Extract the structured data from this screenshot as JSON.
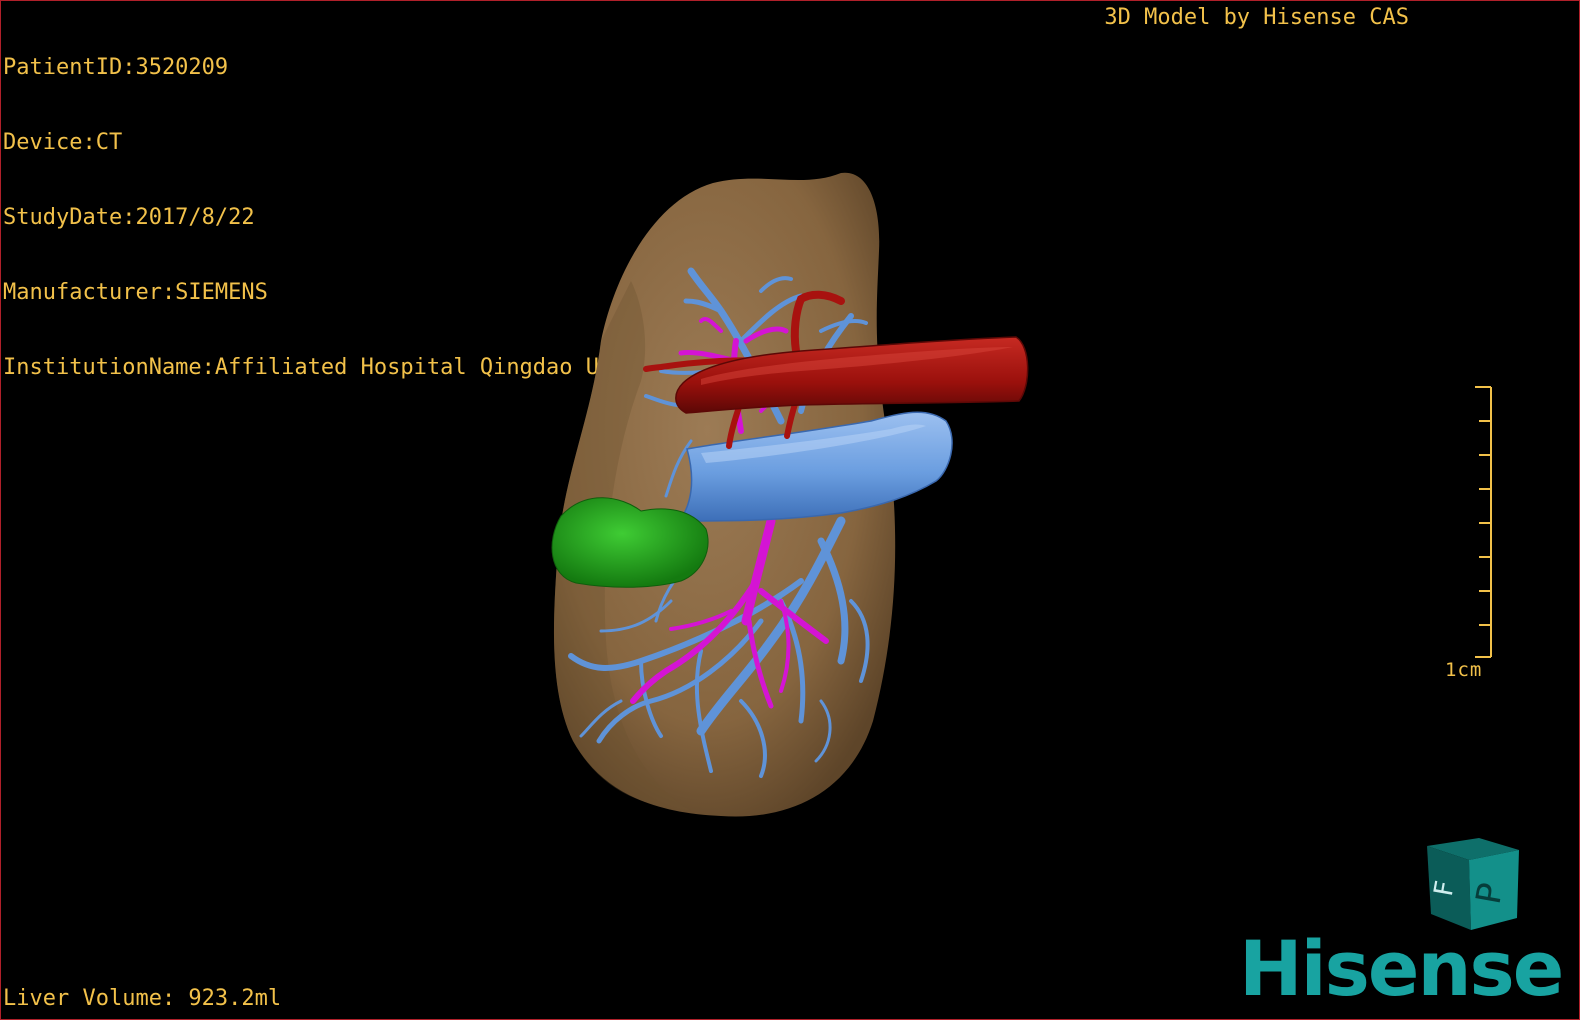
{
  "dicom": {
    "patient_id": "PatientID:3520209",
    "device": "Device:CT",
    "study_date": "StudyDate:2017/8/22",
    "manufacturer": "Manufacturer:SIEMENS",
    "institution": "InstitutionName:Affiliated Hospital Qingdao University-C"
  },
  "credit": "3D Model by Hisense CAS",
  "liver_volume": "Liver Volume: 923.2ml",
  "scale": {
    "label": "1cm"
  },
  "orientation_cube": {
    "face_front": "P",
    "face_side": "F"
  },
  "logo": "Hisense",
  "colors": {
    "overlay_text": "#f2c14a",
    "liver": "#8b6a45",
    "portal_vein": "#5f93d8",
    "hepatic_artery": "#a8120f",
    "bile_duct": "#d414d4",
    "lesion": "#22a31c",
    "brand": "#18a3a1"
  }
}
